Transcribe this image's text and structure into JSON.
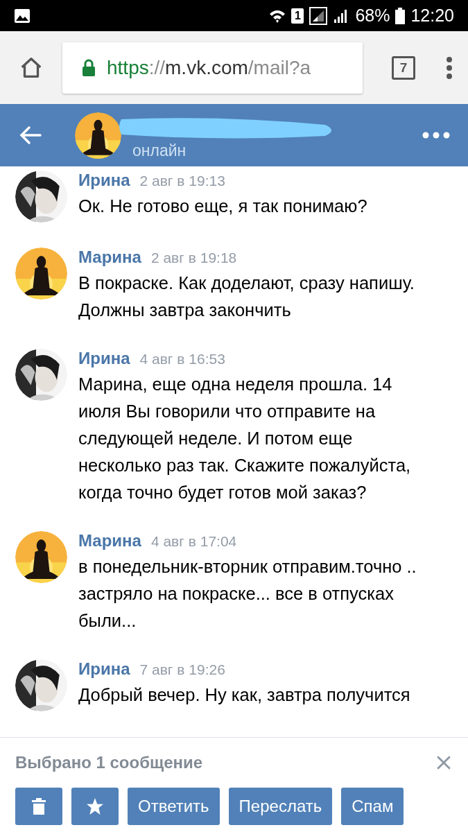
{
  "status_bar": {
    "sim_slot": "1",
    "battery": "68%",
    "time": "12:20"
  },
  "browser": {
    "url": {
      "scheme": "https",
      "separator": "://",
      "host": "m.vk.com",
      "path": "/mail?a"
    },
    "tab_count": "7"
  },
  "chat_header": {
    "status": "онлайн",
    "name_redacted": true
  },
  "messages": [
    {
      "sender": "Ирина",
      "date": "2 авг в 19:13",
      "text": "Ок. Не готово еще, я так понимаю?"
    },
    {
      "sender": "Марина",
      "date": "2 авг в 19:18",
      "text": "В покраске. Как доделают, сразу напишу. Должны завтра закончить"
    },
    {
      "sender": "Ирина",
      "date": "4 авг в 16:53",
      "text": "Марина, еще одна неделя прошла. 14 июля Вы говорили что отправите на следующей неделе. И потом еще несколько раз так. Скажите пожалуйста, когда точно будет готов мой заказ?"
    },
    {
      "sender": "Марина",
      "date": "4 авг в 17:04",
      "text": "в понедельник-вторник отправим.точно .. застряло на покраске... все в отпусках были..."
    },
    {
      "sender": "Ирина",
      "date": "7 авг в 19:26",
      "text": "Добрый вечер. Ну как, завтра получится"
    }
  ],
  "selection_bar": {
    "title": "Выбрано 1 сообщение",
    "actions": [
      {
        "kind": "delete"
      },
      {
        "kind": "favorite"
      },
      {
        "kind": "text",
        "label": "Ответить"
      },
      {
        "kind": "text",
        "label": "Переслать"
      },
      {
        "kind": "text",
        "label": "Спам"
      }
    ]
  }
}
